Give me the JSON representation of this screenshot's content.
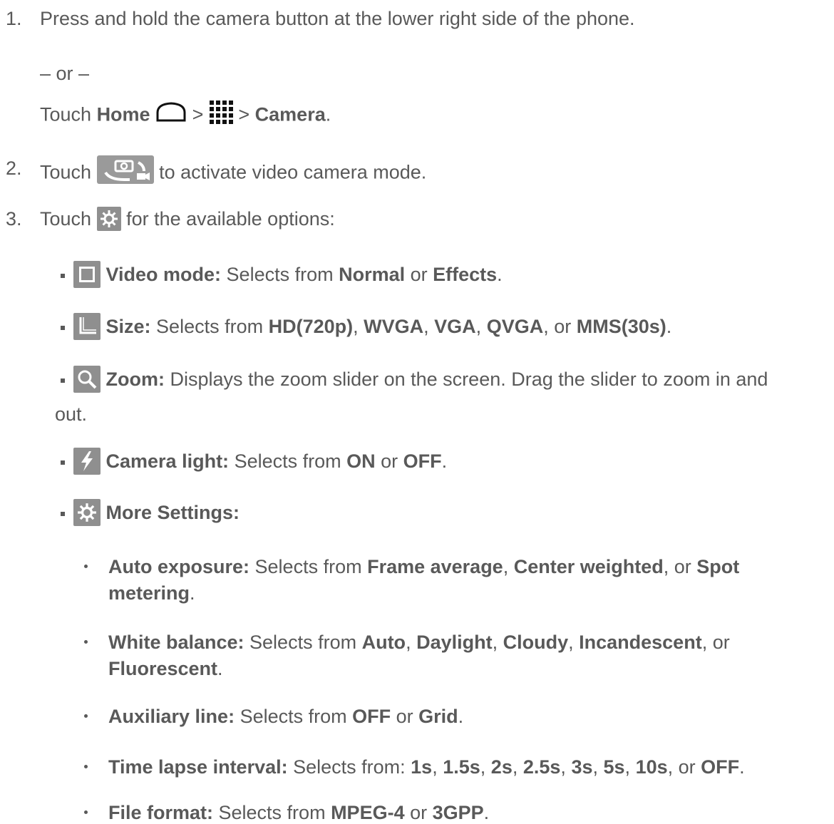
{
  "step1": {
    "num": "1.",
    "text": "Press and hold the camera button at the lower right side of the phone.",
    "or": "– or –",
    "touch": "Touch ",
    "home": "Home",
    "gt1": " > ",
    "gt2": " > ",
    "camera": "Camera",
    "end": "."
  },
  "step2": {
    "num": "2.",
    "touch": "Touch ",
    "text": " to activate video camera mode."
  },
  "step3": {
    "num": "3.",
    "touch": "Touch ",
    "text": " for the available options:"
  },
  "options": {
    "video_mode": {
      "label": "Video mode:",
      "t1": " Selects from ",
      "a": "Normal",
      "or": " or ",
      "b": "Effects",
      "end": "."
    },
    "size": {
      "label": "Size:",
      "t1": " Selects from ",
      "v1": "HD(720p)",
      "c1": ", ",
      "v2": "WVGA",
      "c2": ", ",
      "v3": "VGA",
      "c3": ", ",
      "v4": "QVGA",
      "c4": ", or ",
      "v5": "MMS(30s)",
      "end": "."
    },
    "zoom": {
      "label": "Zoom:",
      "t1": " Displays the zoom slider on the screen. Drag the slider to zoom in and",
      "t2": "out."
    },
    "camera_light": {
      "label": "Camera light:",
      "t1": " Selects from ",
      "a": "ON",
      "or": " or ",
      "b": "OFF",
      "end": "."
    },
    "more_settings": {
      "label": "More Settings:"
    }
  },
  "more": {
    "auto_exposure": {
      "label": "Auto exposure:",
      "t1": " Selects from ",
      "v1": "Frame average",
      "c1": ", ",
      "v2": "Center weighted",
      "c2": ", or ",
      "v3": "Spot",
      "v3b": "metering",
      "end": "."
    },
    "white_balance": {
      "label": "White balance:",
      "t1": " Selects from ",
      "v1": "Auto",
      "c1": ", ",
      "v2": "Daylight",
      "c2": ", ",
      "v3": "Cloudy",
      "c3": ", ",
      "v4": "Incandescent",
      "c4": ", or",
      "v5": "Fluorescent",
      "end": "."
    },
    "auxiliary_line": {
      "label": "Auxiliary line:",
      "t1": " Selects from ",
      "a": "OFF",
      "or": " or ",
      "b": "Grid",
      "end": "."
    },
    "time_lapse": {
      "label": "Time lapse interval:",
      "t1": " Selects from: ",
      "v1": "1s",
      "c1": ", ",
      "v2": "1.5s",
      "c2": ", ",
      "v3": "2s",
      "c3": ", ",
      "v4": "2.5s",
      "c4": ", ",
      "v5": "3s",
      "c5": ", ",
      "v6": "5s",
      "c6": ", ",
      "v7": "10s",
      "c7": ", or ",
      "v8": "OFF",
      "end": "."
    },
    "file_format": {
      "label": "File format:",
      "t1": " Selects from ",
      "a": "MPEG-4",
      "or": " or ",
      "b": "3GPP",
      "end": "."
    }
  },
  "icons": {
    "home": "home-outline-icon",
    "apps": "apps-grid-icon",
    "camera_switch": "camera-video-switch-icon",
    "settings": "settings-gear-icon",
    "video_mode": "frame-square-icon",
    "size": "size-corner-icon",
    "zoom": "magnifier-icon",
    "light": "flash-bolt-icon",
    "more": "settings-gear-icon"
  }
}
